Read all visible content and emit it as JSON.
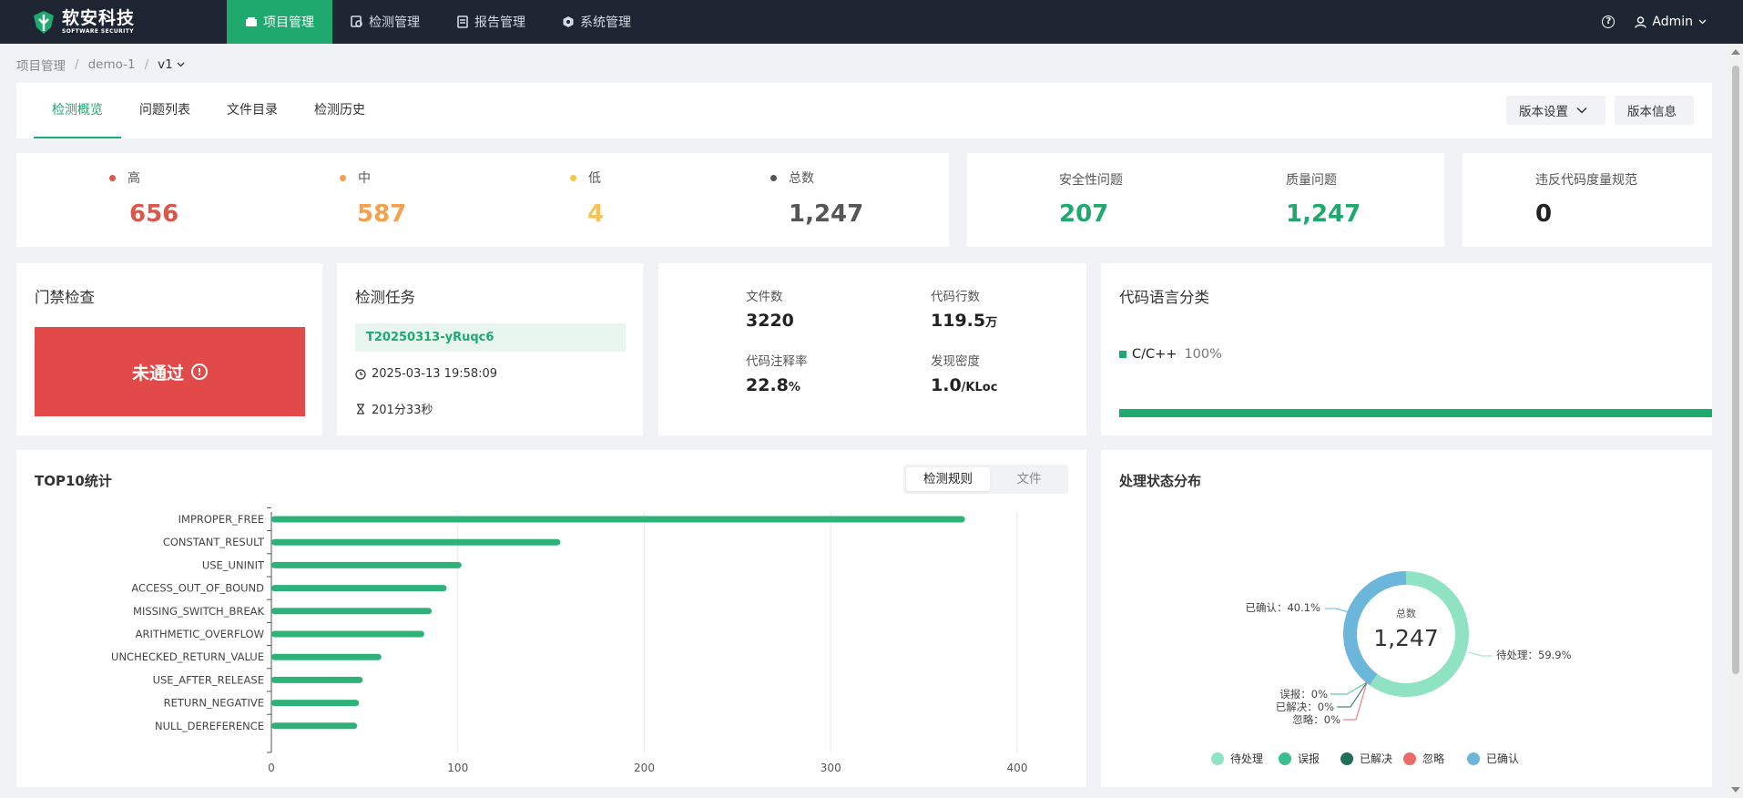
{
  "topbar": {
    "logo": {
      "cn": "软安科技",
      "en": "SOFTWARE SECURITY"
    },
    "nav": [
      {
        "label": "项目管理",
        "icon": "project-icon",
        "active": true
      },
      {
        "label": "检测管理",
        "icon": "detect-icon",
        "active": false
      },
      {
        "label": "报告管理",
        "icon": "report-icon",
        "active": false
      },
      {
        "label": "系统管理",
        "icon": "system-icon",
        "active": false
      }
    ],
    "help": "?",
    "user": "Admin"
  },
  "breadcrumb": {
    "items": [
      "项目管理",
      "demo-1"
    ],
    "current": "v1"
  },
  "tabs": [
    "检测概览",
    "问题列表",
    "文件目录",
    "检测历史"
  ],
  "buttons": {
    "version_settings": "版本设置",
    "version_info": "版本信息"
  },
  "severity": {
    "high": {
      "label": "高",
      "value": "656",
      "color": "#d9574c"
    },
    "mid": {
      "label": "中",
      "value": "587",
      "color": "#f5a04a"
    },
    "low": {
      "label": "低",
      "value": "4",
      "color": "#f5c452"
    },
    "total": {
      "label": "总数",
      "value": "1,247",
      "color": "#555555"
    }
  },
  "issues": {
    "security_label": "安全性问题",
    "security_value": "207",
    "quality_label": "质量问题",
    "quality_value": "1,247"
  },
  "violation": {
    "label": "违反代码度量规范",
    "value": "0"
  },
  "gate": {
    "title": "门禁检查",
    "status": "未通过",
    "info": "!"
  },
  "task": {
    "title": "检测任务",
    "id": "T20250313-yRuqc6",
    "time": "2025-03-13 19:58:09",
    "duration": "201分33秒"
  },
  "metrics": {
    "files_label": "文件数",
    "files_value": "3220",
    "lines_label": "代码行数",
    "lines_value": "119.5",
    "lines_unit": "万",
    "comment_label": "代码注释率",
    "comment_value": "22.8",
    "comment_unit": "%",
    "density_label": "发现密度",
    "density_value": "1.0",
    "density_unit": "/KLoc"
  },
  "language": {
    "title": "代码语言分类",
    "name": "C/C++",
    "percent": "100%",
    "share": 1.0
  },
  "top10": {
    "title": "TOP10统计",
    "toggle": {
      "rule": "检测规则",
      "file": "文件"
    }
  },
  "chart_data": [
    {
      "type": "bar",
      "orientation": "horizontal",
      "title": "TOP10统计",
      "categories": [
        "IMPROPER_FREE",
        "CONSTANT_RESULT",
        "USE_UNINIT",
        "ACCESS_OUT_OF_BOUND",
        "MISSING_SWITCH_BREAK",
        "ARITHMETIC_OVERFLOW",
        "UNCHECKED_RETURN_VALUE",
        "USE_AFTER_RELEASE",
        "RETURN_NEGATIVE",
        "NULL_DEREFERENCE"
      ],
      "values": [
        372,
        155,
        102,
        94,
        86,
        82,
        59,
        49,
        47,
        46
      ],
      "xlim": [
        0,
        400
      ],
      "xticks": [
        0,
        100,
        200,
        300,
        400
      ],
      "grid": true,
      "color": "#2fb27a"
    },
    {
      "type": "pie",
      "title": "处理状态分布",
      "center_label": "总数",
      "center_value": "1,247",
      "slices": [
        {
          "label": "待处理",
          "value": 59.9,
          "text": "待处理：59.9%",
          "color": "#8fe3c2"
        },
        {
          "label": "误报",
          "value": 0,
          "text": "误报：0%",
          "color": "#3bbf8e"
        },
        {
          "label": "已解决",
          "value": 0,
          "text": "已解决：0%",
          "color": "#236e58"
        },
        {
          "label": "忽略",
          "value": 0,
          "text": "忽略：0%",
          "color": "#ec6b66"
        },
        {
          "label": "已确认",
          "value": 40.1,
          "text": "已确认：40.1%",
          "color": "#6cb6dc"
        }
      ],
      "legend": "bottom"
    }
  ]
}
